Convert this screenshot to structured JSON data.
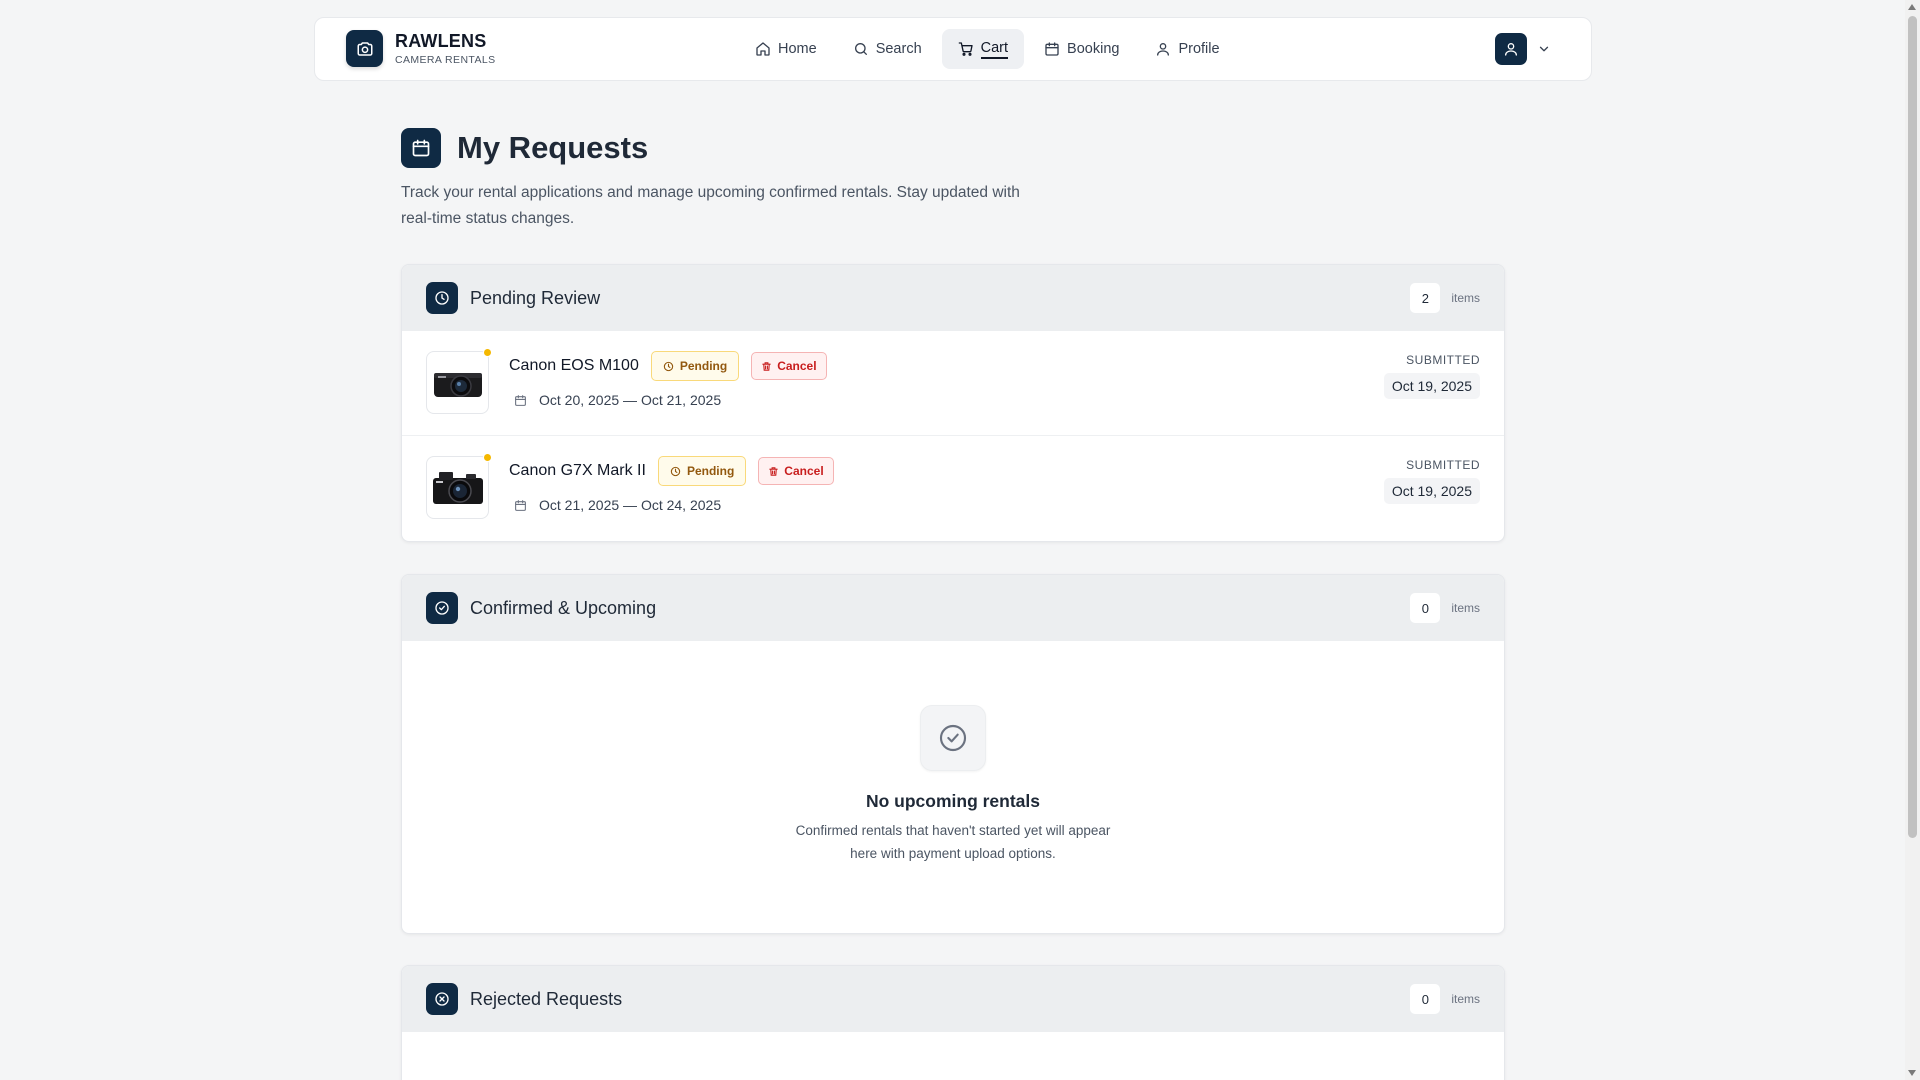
{
  "brand": {
    "name": "RAWLENS",
    "subtitle": "CAMERA RENTALS"
  },
  "nav": {
    "items": [
      {
        "label": "Home",
        "icon": "home-icon"
      },
      {
        "label": "Search",
        "icon": "search-icon"
      },
      {
        "label": "Cart",
        "icon": "cart-icon",
        "active": true
      },
      {
        "label": "Booking",
        "icon": "calendar-icon"
      },
      {
        "label": "Profile",
        "icon": "user-icon"
      }
    ]
  },
  "page": {
    "title": "My Requests",
    "description_line1": "Track your rental applications and manage upcoming confirmed rentals. Stay updated with",
    "description_line2": "real-time status changes."
  },
  "pending": {
    "title": "Pending Review",
    "count": "2",
    "count_unit": "items",
    "requests": [
      {
        "name": "Canon EOS M100",
        "status": "Pending",
        "cancel_label": "Cancel",
        "dates": "Oct 20, 2025 — Oct 21, 2025",
        "submitted_label": "SUBMITTED",
        "submitted_date": "Oct 19, 2025"
      },
      {
        "name": "Canon G7X Mark II",
        "status": "Pending",
        "cancel_label": "Cancel",
        "dates": "Oct 21, 2025 — Oct 24, 2025",
        "submitted_label": "SUBMITTED",
        "submitted_date": "Oct 19, 2025"
      }
    ]
  },
  "confirmed": {
    "title": "Confirmed & Upcoming",
    "count": "0",
    "count_unit": "items",
    "empty_title": "No upcoming rentals",
    "empty_desc_line1": "Confirmed rentals that haven't started yet will appear",
    "empty_desc_line2": "here with payment upload options."
  },
  "rejected": {
    "title": "Rejected Requests",
    "count": "0",
    "count_unit": "items"
  },
  "colors": {
    "brand_navy": "#0f2a44",
    "pending_bg": "#fffbeb",
    "pending_text": "#92580e",
    "cancel_text": "#c81e1e",
    "status_dot": "#f5b800"
  }
}
